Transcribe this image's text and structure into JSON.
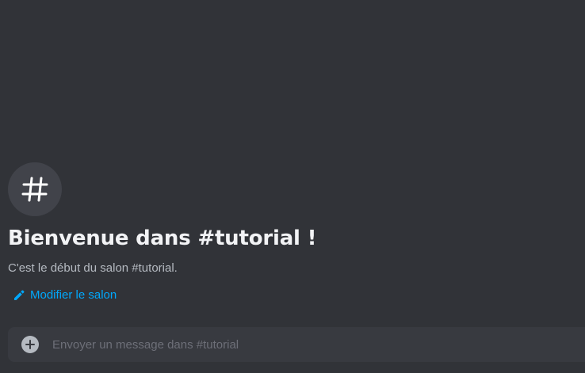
{
  "channel": {
    "icon": "hashtag-icon",
    "welcome_title": "Bienvenue dans #tutorial !",
    "welcome_subtitle": "C'est le début du salon #tutorial.",
    "edit_label": "Modifier le salon",
    "edit_icon": "pencil-icon"
  },
  "composer": {
    "add_icon": "plus-circle-icon",
    "placeholder": "Envoyer un message dans #tutorial",
    "value": ""
  },
  "colors": {
    "background": "#313338",
    "link": "#00a8fc",
    "composer_bg": "#383a40"
  }
}
